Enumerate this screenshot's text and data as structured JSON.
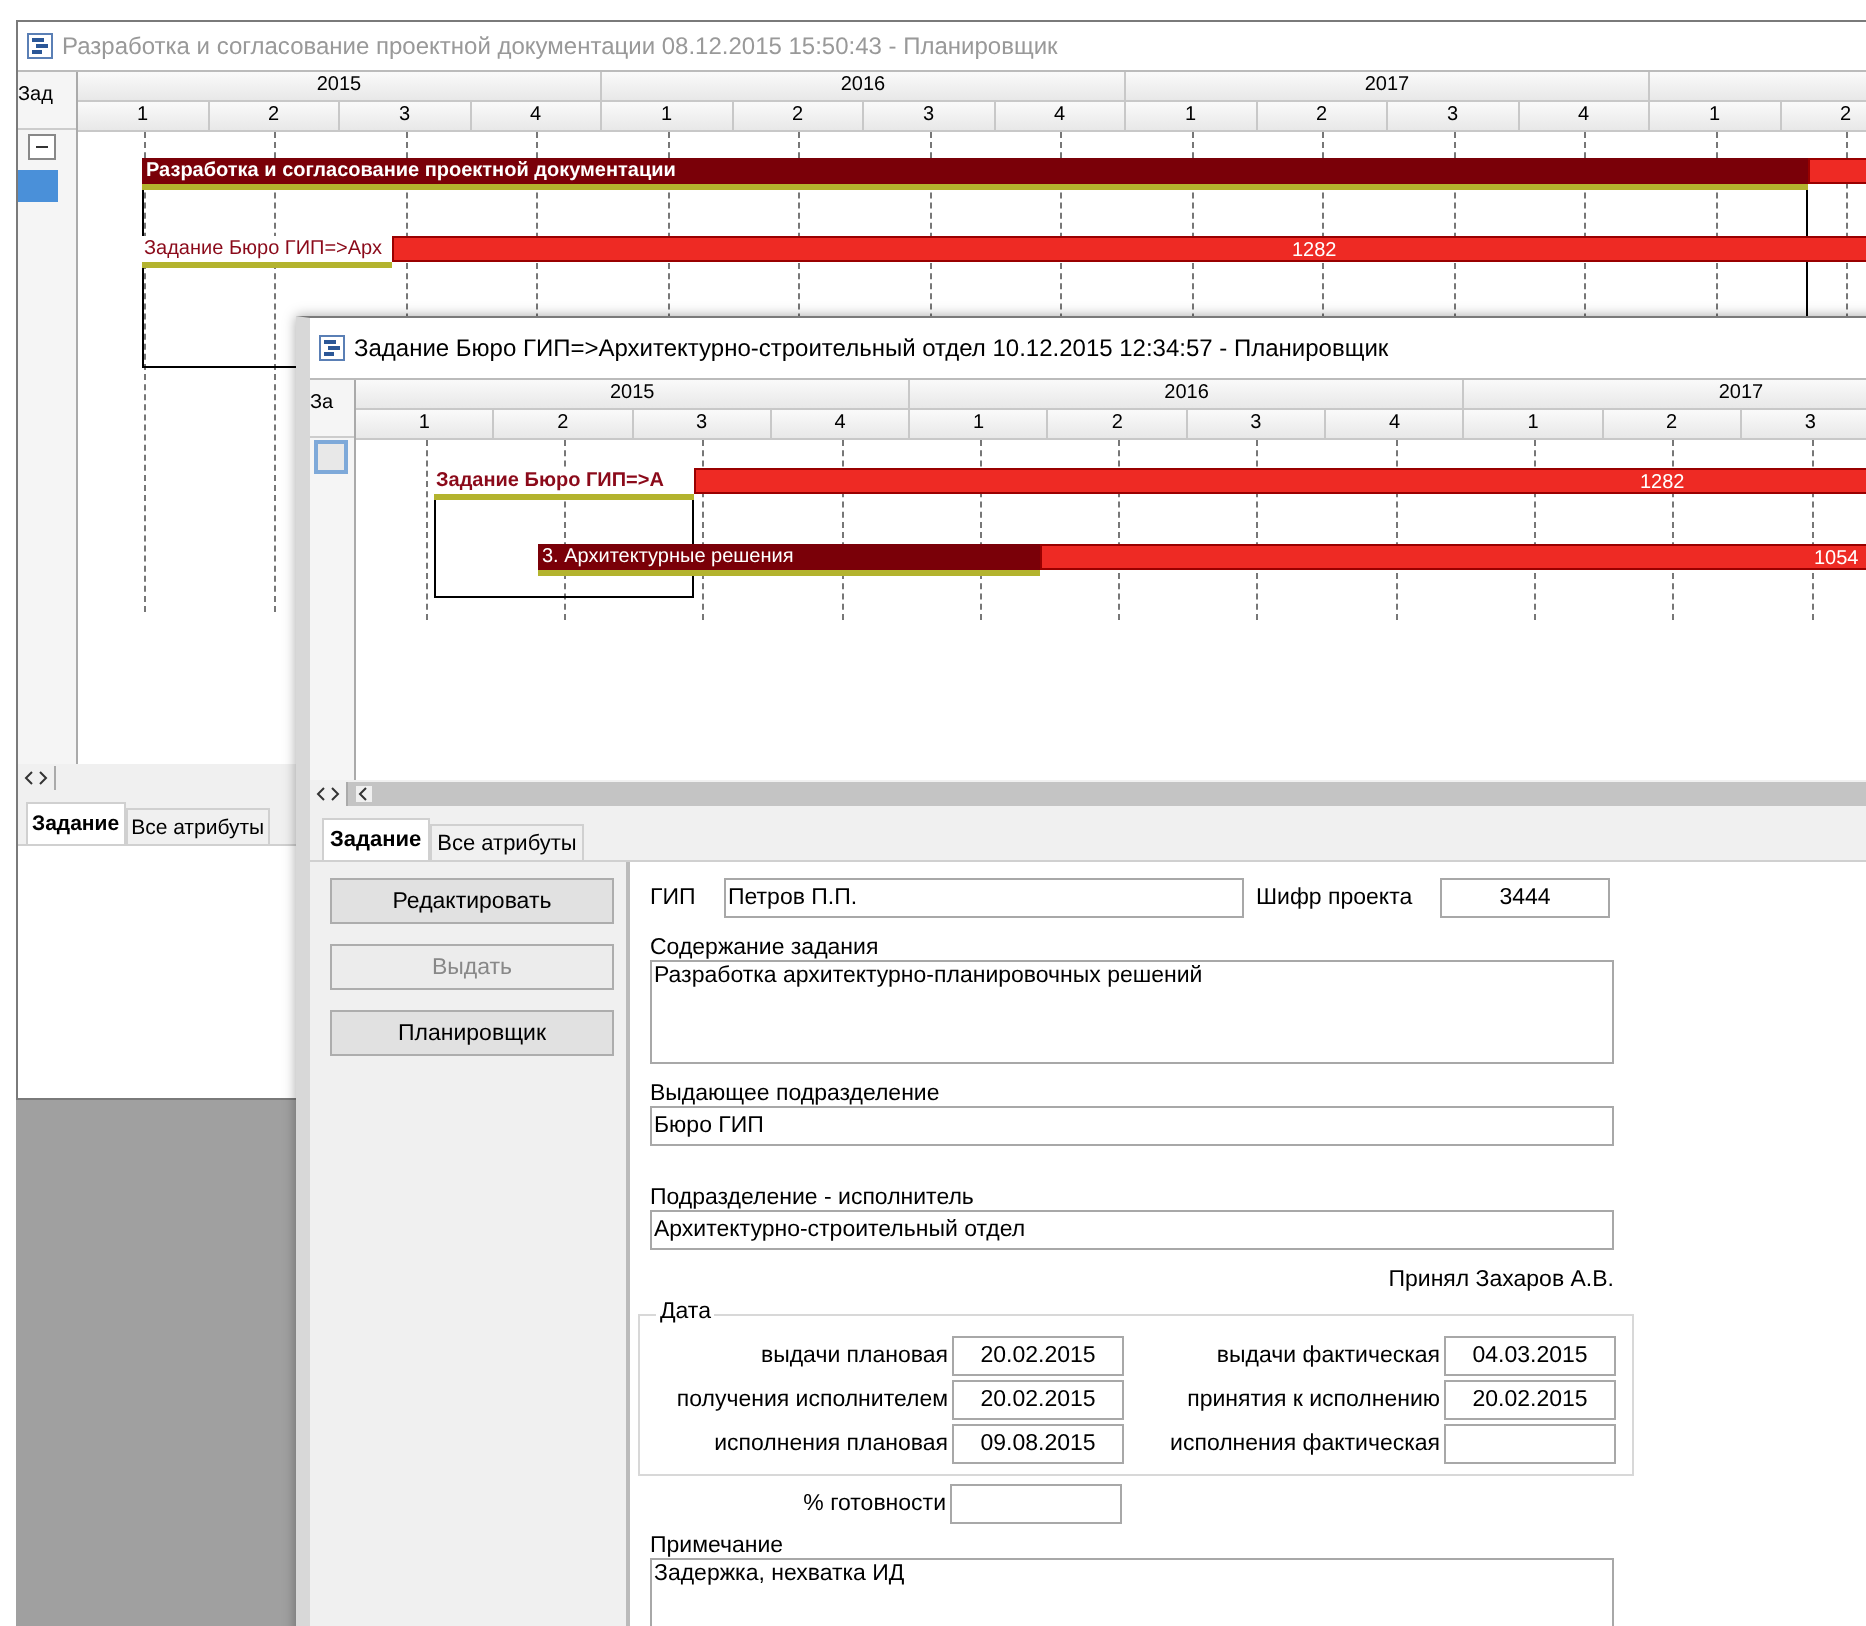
{
  "back_window": {
    "title": "Разработка и согласование проектной документации 08.12.2015 15:50:43 - Планировщик",
    "active": false,
    "column_header": "Зад",
    "timeline": [
      {
        "year": "2015",
        "quarters": [
          "1",
          "2",
          "3",
          "4"
        ]
      },
      {
        "year": "2016",
        "quarters": [
          "1",
          "2",
          "3",
          "4"
        ]
      },
      {
        "year": "2017",
        "quarters": [
          "1",
          "2",
          "3",
          "4"
        ]
      },
      {
        "quarters": [
          "1",
          "2"
        ]
      }
    ],
    "bars": [
      {
        "kind": "summary",
        "label": "Разработка и согласование проектной документации"
      },
      {
        "kind": "task",
        "label": "Задание Бюро ГИП=>Арх",
        "value": "1282"
      }
    ],
    "tabs": [
      {
        "label": "Задание",
        "selected": true
      },
      {
        "label": "Все атрибуты",
        "selected": false
      }
    ]
  },
  "front_window": {
    "title": "Задание Бюро ГИП=>Архитектурно-строительный отдел 10.12.2015 12:34:57 - Планировщик",
    "active": true,
    "column_header": "За",
    "timeline": [
      {
        "year": "2015",
        "quarters": [
          "1",
          "2",
          "3",
          "4"
        ]
      },
      {
        "year": "2016",
        "quarters": [
          "1",
          "2",
          "3",
          "4"
        ]
      },
      {
        "year": "2017",
        "quarters": [
          "1",
          "2",
          "3"
        ]
      }
    ],
    "bars": [
      {
        "kind": "task",
        "label": "Задание Бюро ГИП=>А",
        "value": "1282"
      },
      {
        "kind": "summary",
        "label": "3. Архитектурные решения",
        "value": "1054"
      }
    ],
    "tabs": [
      {
        "label": "Задание",
        "selected": true
      },
      {
        "label": "Все атрибуты",
        "selected": false
      }
    ],
    "buttons": [
      {
        "label": "Редактировать",
        "disabled": false
      },
      {
        "label": "Выдать",
        "disabled": true
      },
      {
        "label": "Планировщик",
        "disabled": false
      }
    ],
    "form": {
      "gip_label": "ГИП",
      "gip_value": "Петров П.П.",
      "cipher_label": "Шифр проекта",
      "cipher_value": "3444",
      "content_label": "Содержание задания",
      "content_value": "Разработка архитектурно-планировочных решений",
      "issuer_label": "Выдающее подразделение",
      "issuer_value": "Бюро ГИП",
      "executor_label": "Подразделение - исполнитель",
      "executor_value": "Архитектурно-строительный отдел",
      "accepted": "Принял Захаров А.В.",
      "dates": {
        "legend": "Дата",
        "rows": [
          [
            {
              "label": "выдачи плановая",
              "value": "20.02.2015"
            },
            {
              "label": "выдачи фактическая",
              "value": "04.03.2015"
            }
          ],
          [
            {
              "label": "получения исполнителем",
              "value": "20.02.2015"
            },
            {
              "label": "принятия к исполнению",
              "value": "20.02.2015"
            }
          ],
          [
            {
              "label": "исполнения плановая",
              "value": "09.08.2015"
            },
            {
              "label": "исполнения фактическая"
            }
          ]
        ]
      },
      "readiness_label": "% готовности",
      "note_label": "Примечание",
      "note_value": "Задержка, нехватка ИД"
    }
  }
}
